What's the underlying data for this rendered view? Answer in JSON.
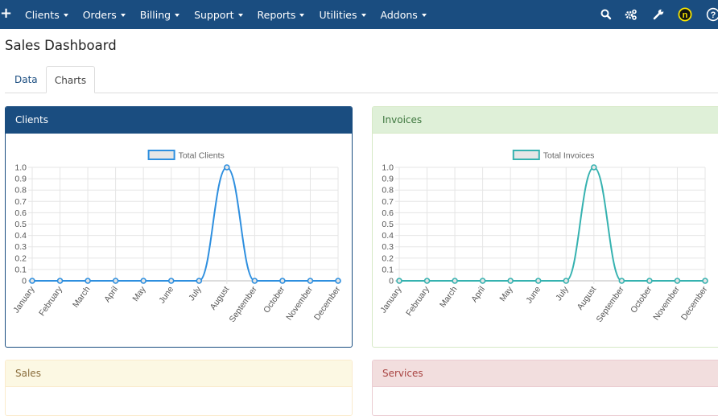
{
  "nav": {
    "add_label": "+",
    "items": [
      {
        "label": "Clients"
      },
      {
        "label": "Orders"
      },
      {
        "label": "Billing"
      },
      {
        "label": "Support"
      },
      {
        "label": "Reports"
      },
      {
        "label": "Utilities"
      },
      {
        "label": "Addons"
      }
    ],
    "icons": [
      "search-icon",
      "gears-icon",
      "wrench-icon",
      "notification-badge-icon",
      "help-icon"
    ],
    "badge_letter": "n",
    "help_glyph": "?"
  },
  "page": {
    "title": "Sales Dashboard",
    "tabs": [
      {
        "label": "Data",
        "active": false
      },
      {
        "label": "Charts",
        "active": true
      }
    ]
  },
  "panels": {
    "clients": {
      "title": "Clients"
    },
    "invoices": {
      "title": "Invoices"
    },
    "sales": {
      "title": "Sales"
    },
    "services": {
      "title": "Services"
    }
  },
  "colors": {
    "nav_bg": "#1a4d80",
    "clients_line": "#2e8fdf",
    "invoices_line": "#36b2b0"
  },
  "chart_data": [
    {
      "type": "line",
      "id": "clients",
      "legend": "Total Clients",
      "legend_position": "top",
      "categories": [
        "January",
        "February",
        "March",
        "April",
        "May",
        "June",
        "July",
        "August",
        "September",
        "October",
        "November",
        "December"
      ],
      "values": [
        0,
        0,
        0,
        0,
        0,
        0,
        0,
        1,
        0,
        0,
        0,
        0
      ],
      "y_ticks": [
        "0",
        "0.1",
        "0.2",
        "0.3",
        "0.4",
        "0.5",
        "0.6",
        "0.7",
        "0.8",
        "0.9",
        "1.0"
      ],
      "ylim": [
        0,
        1
      ],
      "grid": true
    },
    {
      "type": "line",
      "id": "invoices",
      "legend": "Total Invoices",
      "legend_position": "top",
      "categories": [
        "January",
        "February",
        "March",
        "April",
        "May",
        "June",
        "July",
        "August",
        "September",
        "October",
        "November",
        "December"
      ],
      "values": [
        0,
        0,
        0,
        0,
        0,
        0,
        0,
        1,
        0,
        0,
        0,
        0
      ],
      "y_ticks": [
        "0",
        "0.1",
        "0.2",
        "0.3",
        "0.4",
        "0.5",
        "0.6",
        "0.7",
        "0.8",
        "0.9",
        "1.0"
      ],
      "ylim": [
        0,
        1
      ],
      "grid": true
    }
  ]
}
